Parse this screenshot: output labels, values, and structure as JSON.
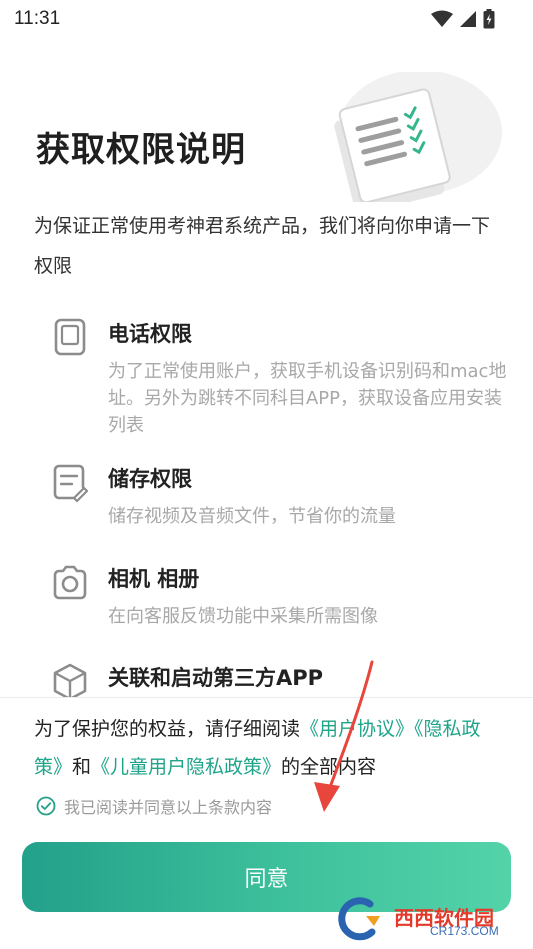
{
  "status": {
    "time": "11:31"
  },
  "page": {
    "title": "获取权限说明",
    "intro": "为保证正常使用考神君系统产品，我们将向你申请一下权限"
  },
  "permissions": [
    {
      "icon": "phone-icon",
      "title": "电话权限",
      "desc": "为了正常使用账户，获取手机设备识别码和mac地址。另外为跳转不同科目APP，获取设备应用安装列表"
    },
    {
      "icon": "storage-icon",
      "title": "储存权限",
      "desc": "储存视频及音频文件，节省你的流量"
    },
    {
      "icon": "camera-icon",
      "title": "相机 相册",
      "desc": "在向客服反馈功能中采集所需图像"
    },
    {
      "icon": "cube-icon",
      "title": "关联和启动第三方APP",
      "desc": ""
    }
  ],
  "notice": {
    "prefix": "为了保护您的权益，请仔细阅读",
    "user_agreement": "《用户协议》",
    "privacy_policy": "《隐私政策》",
    "conj": "和",
    "child_privacy": "《儿童用户隐私政策》",
    "suffix": "的全部内容"
  },
  "agree_checkbox": {
    "label": "我已阅读并同意以上条款内容",
    "checked": true
  },
  "agree_button": {
    "label": "同意"
  },
  "watermark": {
    "main": "西西软件园",
    "sub": "CR173.COM"
  },
  "colors": {
    "accent": "#23a08a",
    "link": "#1fa48a",
    "annotation_arrow": "#e8453c"
  }
}
